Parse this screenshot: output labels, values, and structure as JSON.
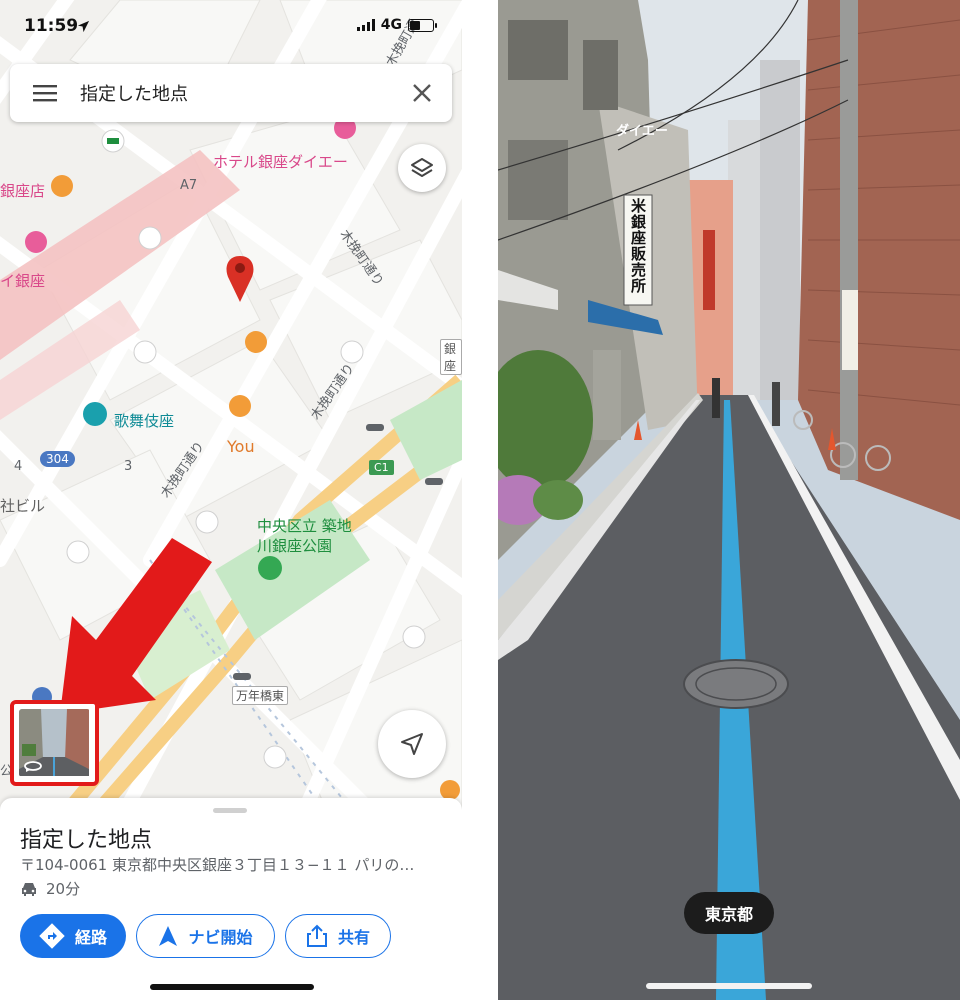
{
  "status_bar": {
    "time": "11:59",
    "network": "4G"
  },
  "search": {
    "query": "指定した地点"
  },
  "map": {
    "labels": {
      "hotel": "ホテル銀座ダイエー",
      "ginza_ten": "銀座店",
      "i_ginza": "イ銀座",
      "kabukiza": "歌舞伎座",
      "you": "You",
      "park_line1": "中央区立 築地",
      "park_line2": "川銀座公園",
      "sha_biru": "社ビル",
      "kobiki1": "木挽町通り",
      "kobiki2": "木挽町通り",
      "kobiki3": "木挽町通り",
      "ko_road_top": "木挽町通",
      "a7": "A7",
      "num4": "4",
      "num3": "3",
      "park_left": "公園"
    },
    "signs": {
      "mannenbashi": "万年橋東",
      "gin": "銀座",
      "route_304": "304",
      "c1": "C1"
    }
  },
  "place": {
    "title": "指定した地点",
    "address": "〒104-0061 東京都中央区銀座３丁目１３−１１ パリの…",
    "eta": "20分"
  },
  "actions": {
    "route": "経路",
    "navigate": "ナビ開始",
    "share": "共有"
  },
  "street_view": {
    "location": "東京都",
    "sign_text": "米銀座販売所",
    "banner": "ダイエー"
  },
  "colors": {
    "accent": "#1a73e8",
    "highlight_red": "#e21a1a",
    "map_bg": "#f2f1ee",
    "pin_red": "#d93025"
  }
}
